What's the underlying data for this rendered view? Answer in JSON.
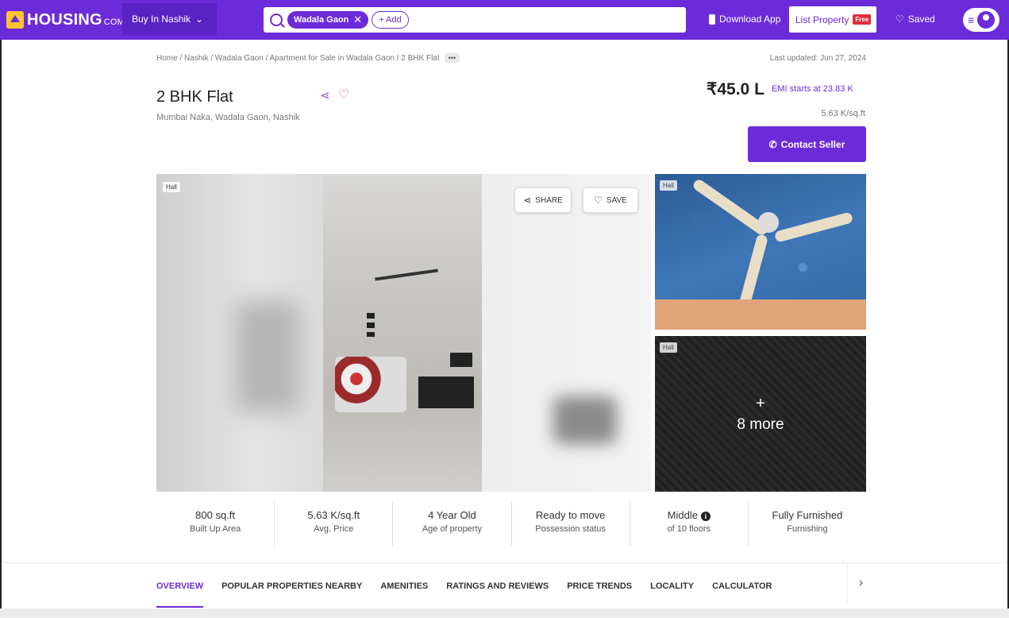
{
  "nav": {
    "logo_main": "HOUSING",
    "logo_suffix": "COM",
    "buy_dropdown": "Buy In Nashik",
    "search_chip": "Wadala Gaon",
    "add_chip": "+ Add",
    "download_app": "Download App",
    "list_property": "List Property",
    "free_badge": "Free",
    "saved": "Saved"
  },
  "breadcrumb": {
    "text": "Home / Nashik / Wadala Gaon / Apartment for Sale in Wadala Gaon / 2 BHK Flat",
    "more": "•••"
  },
  "last_updated": "Last updated: Jun 27, 2024",
  "listing": {
    "title": "2 BHK Flat",
    "address": "Mumbai Naka, Wadala Gaon, Nashik",
    "price": "₹45.0 L",
    "emi": "EMI starts at  23.83 K",
    "per_sqft": "5.63 K/sq.ft",
    "contact_button": "Contact Seller"
  },
  "gallery": {
    "tag_main": "Hall",
    "tag_side1": "Hall",
    "tag_side2": "Hall",
    "share_button": "SHARE",
    "save_button": "SAVE",
    "more_plus": "+",
    "more_text": "8 more"
  },
  "stats": [
    {
      "value": "800 sq.ft",
      "label": "Built Up Area"
    },
    {
      "value": "5.63 K/sq.ft",
      "label": "Avg. Price"
    },
    {
      "value": "4 Year Old",
      "label": "Age of property"
    },
    {
      "value": "Ready to move",
      "label": "Possession status"
    },
    {
      "value": "Middle",
      "label": "of 10 floors"
    },
    {
      "value": "Fully Furnished",
      "label": "Furnishing"
    }
  ],
  "tabs": [
    "OVERVIEW",
    "POPULAR PROPERTIES NEARBY",
    "AMENITIES",
    "RATINGS AND REVIEWS",
    "PRICE TRENDS",
    "LOCALITY",
    "CALCULATOR"
  ],
  "colors": {
    "brand": "#6c2bd9",
    "free": "#e02d3c"
  }
}
